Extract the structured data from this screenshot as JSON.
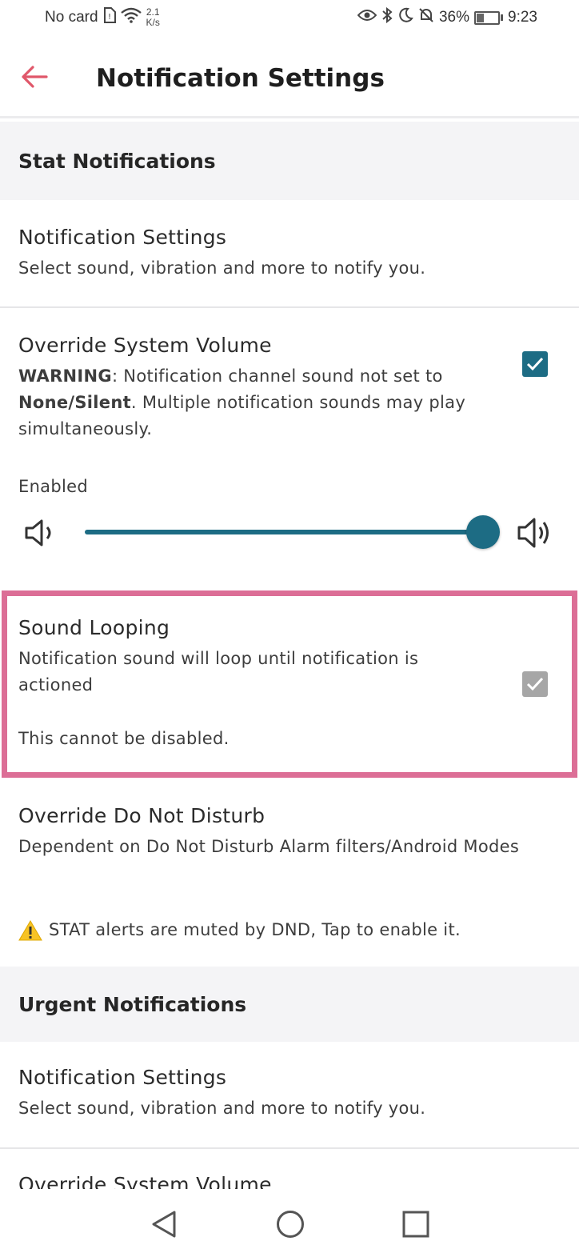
{
  "status_bar": {
    "carrier": "No card",
    "speed_value": "2.1",
    "speed_unit": "K/s",
    "battery": "36%",
    "time": "9:23",
    "battery_level": 0.36
  },
  "header": {
    "title": "Notification Settings"
  },
  "stat_section": {
    "title": "Stat Notifications",
    "notification_settings": {
      "title": "Notification Settings",
      "desc": "Select sound, vibration and more to notify you."
    },
    "override_volume": {
      "title": "Override System Volume",
      "warning_label": "WARNING",
      "warning_text_1": ": Notification channel sound not set to",
      "warning_bold": "None/Silent",
      "warning_text_2": ". Multiple notification sounds may play simultaneously.",
      "checked": true,
      "status": "Enabled",
      "volume_level": 1.0
    },
    "sound_looping": {
      "title": "Sound Looping",
      "desc": "Notification sound will loop until notification is actioned",
      "note": "This cannot be disabled.",
      "checked": true
    },
    "override_dnd": {
      "title": "Override Do Not Disturb",
      "desc": "Dependent on Do Not Disturb Alarm filters/Android Modes",
      "alert": "STAT alerts are muted by DND, Tap to enable it."
    }
  },
  "urgent_section": {
    "title": "Urgent Notifications",
    "notification_settings": {
      "title": "Notification Settings",
      "desc": "Select sound, vibration and more to notify you."
    },
    "override_volume": {
      "title": "Override System Volume"
    }
  },
  "colors": {
    "accent": "#1d6c84",
    "back_arrow": "#e0576a",
    "highlight": "#dc6e96"
  }
}
